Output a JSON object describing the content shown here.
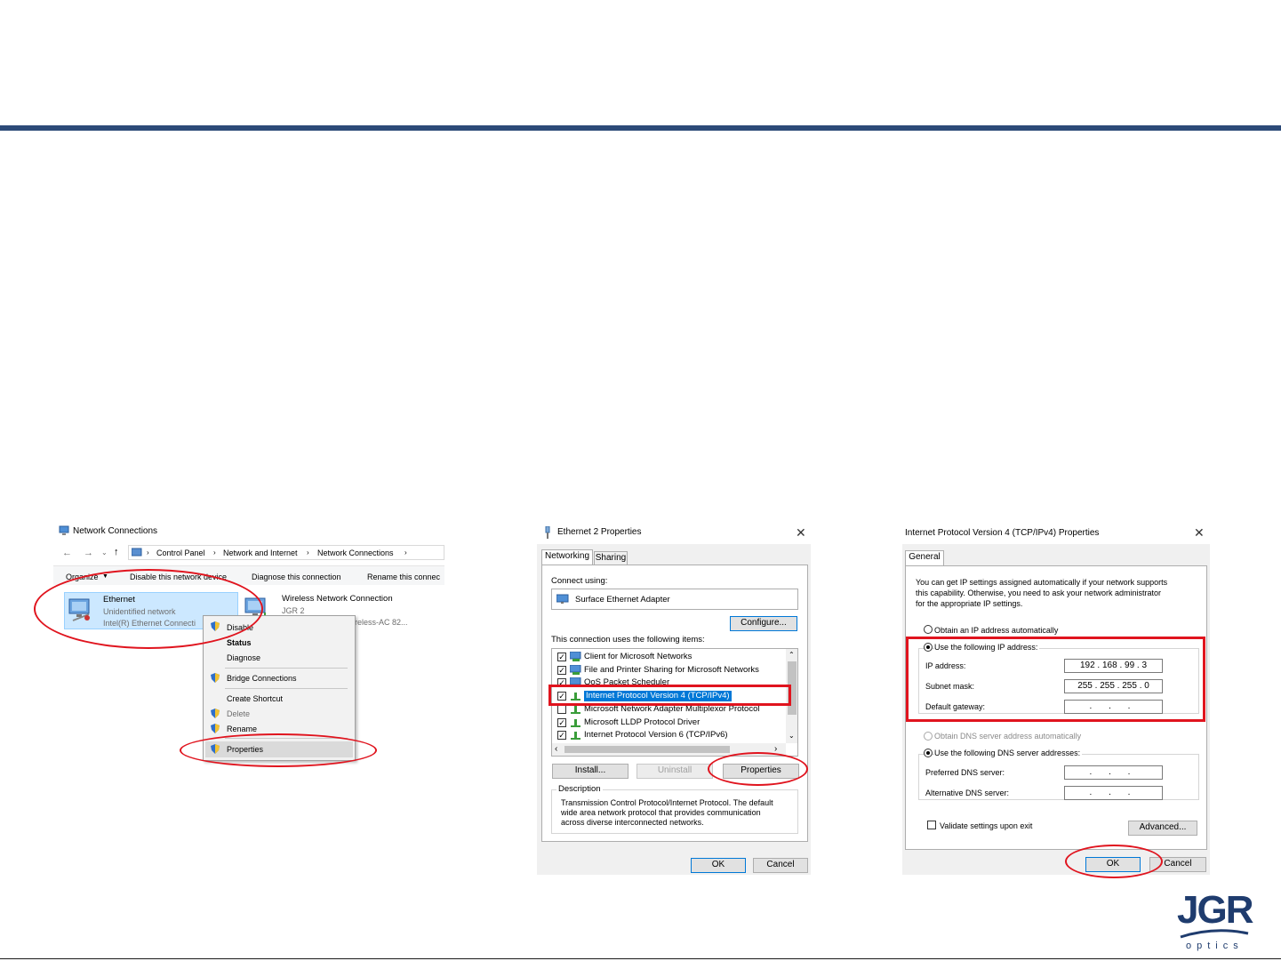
{
  "logo": {
    "brand": "JGR",
    "sub": "optics"
  },
  "network_connections": {
    "title": "Network Connections",
    "breadcrumb": [
      "Control Panel",
      "Network and Internet",
      "Network Connections"
    ],
    "toolbar": {
      "organize": "Organize",
      "disable": "Disable this network device",
      "diagnose": "Diagnose this connection",
      "rename": "Rename this connec"
    },
    "ethernet": {
      "name": "Ethernet",
      "status": "Unidentified network",
      "adapter": "Intel(R) Ethernet Connecti"
    },
    "wireless": {
      "name": "Wireless Network Connection",
      "ssid": "JGR 2",
      "adapter": "ireless-AC 82..."
    },
    "context_menu": {
      "disable": "Disable",
      "status": "Status",
      "diagnose": "Diagnose",
      "bridge": "Bridge Connections",
      "shortcut": "Create Shortcut",
      "delete": "Delete",
      "rename": "Rename",
      "properties": "Properties"
    }
  },
  "ethernet_props": {
    "title": "Ethernet 2 Properties",
    "tabs": [
      "Networking",
      "Sharing"
    ],
    "connect_using_label": "Connect using:",
    "adapter": "Surface Ethernet Adapter",
    "configure": "Configure...",
    "items_label": "This connection uses the following items:",
    "items": [
      {
        "label": "Client for Microsoft Networks",
        "checked": true
      },
      {
        "label": "File and Printer Sharing for Microsoft Networks",
        "checked": true
      },
      {
        "label": "QoS Packet Scheduler",
        "checked": true
      },
      {
        "label": "Internet Protocol Version 4 (TCP/IPv4)",
        "checked": true
      },
      {
        "label": "Microsoft Network Adapter Multiplexor Protocol",
        "checked": false
      },
      {
        "label": "Microsoft LLDP Protocol Driver",
        "checked": true
      },
      {
        "label": "Internet Protocol Version 6 (TCP/IPv6)",
        "checked": true
      }
    ],
    "install": "Install...",
    "uninstall": "Uninstall",
    "properties": "Properties",
    "description_label": "Description",
    "description": [
      "Transmission Control Protocol/Internet Protocol. The default",
      "wide area network protocol that provides communication",
      "across diverse interconnected networks."
    ],
    "ok": "OK",
    "cancel": "Cancel"
  },
  "ipv4_props": {
    "title": "Internet Protocol Version 4 (TCP/IPv4) Properties",
    "tab": "General",
    "intro": [
      "You can get IP settings assigned automatically if your network supports",
      "this capability. Otherwise, you need to ask your network administrator",
      "for the appropriate IP settings."
    ],
    "auto_ip": "Obtain an IP address automatically",
    "use_ip": "Use the following IP address:",
    "ip_label": "IP address:",
    "ip_value": "192 . 168 . 99 . 3",
    "mask_label": "Subnet mask:",
    "mask_value": "255 . 255 . 255 . 0",
    "gateway_label": "Default gateway:",
    "gateway_value": ". . .",
    "auto_dns": "Obtain DNS server address automatically",
    "use_dns": "Use the following DNS server addresses:",
    "pref_dns_label": "Preferred DNS server:",
    "pref_dns_value": ". . .",
    "alt_dns_label": "Alternative DNS server:",
    "alt_dns_value": ". . .",
    "validate": "Validate settings upon exit",
    "advanced": "Advanced...",
    "ok": "OK",
    "cancel": "Cancel"
  }
}
